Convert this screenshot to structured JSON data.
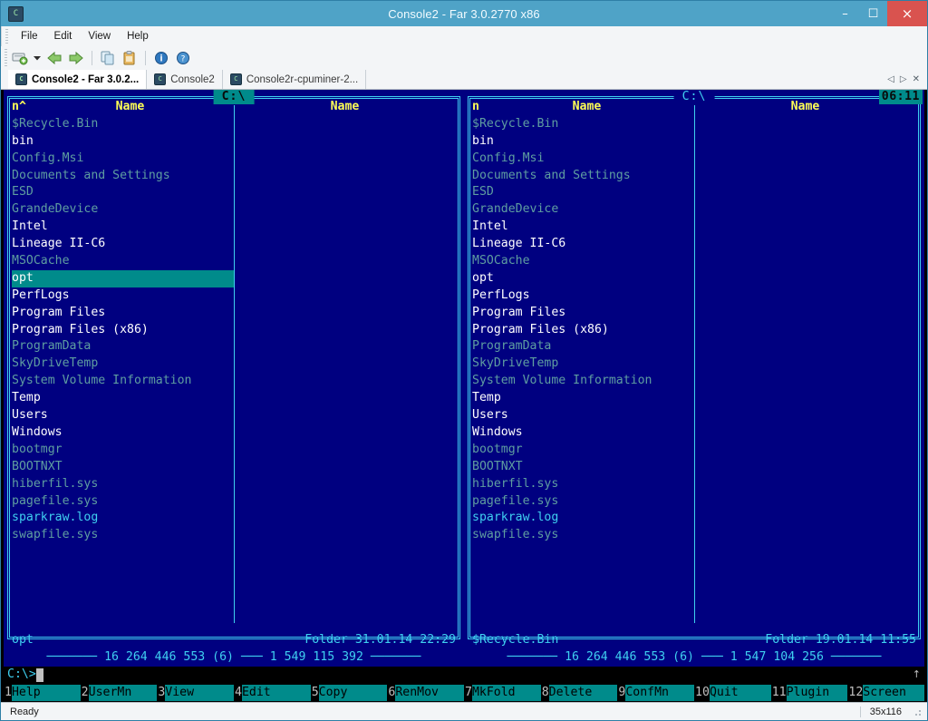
{
  "window": {
    "title": "Console2 - Far 3.0.2770 x86",
    "app_icon": "console-icon",
    "minimize_label": "–",
    "maximize_label": "☐",
    "close_label": "×"
  },
  "menu": {
    "items": [
      "File",
      "Edit",
      "View",
      "Help"
    ]
  },
  "toolbar": {
    "items": [
      {
        "name": "new-tab-icon",
        "glyph": "❐"
      },
      {
        "name": "new-tab-dropdown-icon",
        "glyph": "▼"
      },
      {
        "name": "back-icon",
        "glyph": "←"
      },
      {
        "name": "forward-icon",
        "glyph": "→"
      },
      {
        "name": "copy-icon",
        "glyph": "⧉"
      },
      {
        "name": "paste-icon",
        "glyph": "ὌB"
      },
      {
        "name": "info-icon",
        "glyph": "i"
      },
      {
        "name": "help-icon",
        "glyph": "?"
      }
    ]
  },
  "tabs": {
    "items": [
      {
        "label": "Console2 - Far 3.0.2...",
        "active": true
      },
      {
        "label": "Console2",
        "active": false
      },
      {
        "label": "Console2r-cpuminer-2...",
        "active": false
      }
    ],
    "nav": {
      "prev": "◁",
      "next": "▷",
      "close": "✕"
    }
  },
  "far": {
    "clock": "06:11",
    "left_panel": {
      "title": "C:\\",
      "active": true,
      "header": {
        "sort_mark": "n^",
        "col1": "Name",
        "col2": "Name"
      },
      "entries": [
        {
          "name": "$Recycle.Bin",
          "style": "dim"
        },
        {
          "name": "bin",
          "style": "white"
        },
        {
          "name": "Config.Msi",
          "style": "dim"
        },
        {
          "name": "Documents and Settings",
          "style": "dim"
        },
        {
          "name": "ESD",
          "style": "dim"
        },
        {
          "name": "GrandeDevice",
          "style": "dim"
        },
        {
          "name": "Intel",
          "style": "white"
        },
        {
          "name": "Lineage II-C6",
          "style": "white"
        },
        {
          "name": "MSOCache",
          "style": "dim"
        },
        {
          "name": "opt",
          "style": "white",
          "selected": true
        },
        {
          "name": "PerfLogs",
          "style": "white"
        },
        {
          "name": "Program Files",
          "style": "white"
        },
        {
          "name": "Program Files (x86)",
          "style": "white"
        },
        {
          "name": "ProgramData",
          "style": "dim"
        },
        {
          "name": "SkyDriveTemp",
          "style": "dim"
        },
        {
          "name": "System Volume Information",
          "style": "dim"
        },
        {
          "name": "Temp",
          "style": "white"
        },
        {
          "name": "Users",
          "style": "white"
        },
        {
          "name": "Windows",
          "style": "white"
        },
        {
          "name": "bootmgr",
          "style": "dim"
        },
        {
          "name": "BOOTNXT",
          "style": "dim"
        },
        {
          "name": "hiberfil.sys",
          "style": "dim"
        },
        {
          "name": "pagefile.sys",
          "style": "dim"
        },
        {
          "name": "sparkraw.log",
          "style": "cyan"
        },
        {
          "name": "swapfile.sys",
          "style": "dim"
        }
      ],
      "info_name": "opt",
      "info_meta": "Folder 31.01.14 22:29",
      "totals_left": "16 264 446 553 (6)",
      "totals_right": "1 549 115 392"
    },
    "right_panel": {
      "title": "C:\\",
      "active": false,
      "header": {
        "sort_mark": "n",
        "col1": "Name",
        "col2": "Name"
      },
      "entries": [
        {
          "name": "$Recycle.Bin",
          "style": "dim"
        },
        {
          "name": "bin",
          "style": "white"
        },
        {
          "name": "Config.Msi",
          "style": "dim"
        },
        {
          "name": "Documents and Settings",
          "style": "dim"
        },
        {
          "name": "ESD",
          "style": "dim"
        },
        {
          "name": "GrandeDevice",
          "style": "dim"
        },
        {
          "name": "Intel",
          "style": "white"
        },
        {
          "name": "Lineage II-C6",
          "style": "white"
        },
        {
          "name": "MSOCache",
          "style": "dim"
        },
        {
          "name": "opt",
          "style": "white"
        },
        {
          "name": "PerfLogs",
          "style": "white"
        },
        {
          "name": "Program Files",
          "style": "white"
        },
        {
          "name": "Program Files (x86)",
          "style": "white"
        },
        {
          "name": "ProgramData",
          "style": "dim"
        },
        {
          "name": "SkyDriveTemp",
          "style": "dim"
        },
        {
          "name": "System Volume Information",
          "style": "dim"
        },
        {
          "name": "Temp",
          "style": "white"
        },
        {
          "name": "Users",
          "style": "white"
        },
        {
          "name": "Windows",
          "style": "white"
        },
        {
          "name": "bootmgr",
          "style": "dim"
        },
        {
          "name": "BOOTNXT",
          "style": "dim"
        },
        {
          "name": "hiberfil.sys",
          "style": "dim"
        },
        {
          "name": "pagefile.sys",
          "style": "dim"
        },
        {
          "name": "sparkraw.log",
          "style": "cyan"
        },
        {
          "name": "swapfile.sys",
          "style": "dim"
        }
      ],
      "info_name": "$Recycle.Bin",
      "info_meta": "Folder 19.01.14 11:55",
      "totals_left": "16 264 446 553 (6)",
      "totals_right": "1 547 104 256"
    },
    "command_line": {
      "prompt": "C:\\>",
      "value": "",
      "scroll_indicator": "↑"
    },
    "function_keys": [
      {
        "num": "1",
        "label": "Help"
      },
      {
        "num": "2",
        "label": "UserMn"
      },
      {
        "num": "3",
        "label": "View"
      },
      {
        "num": "4",
        "label": "Edit"
      },
      {
        "num": "5",
        "label": "Copy"
      },
      {
        "num": "6",
        "label": "RenMov"
      },
      {
        "num": "7",
        "label": "MkFold"
      },
      {
        "num": "8",
        "label": "Delete"
      },
      {
        "num": "9",
        "label": "ConfMn"
      },
      {
        "num": "10",
        "label": "Quit"
      },
      {
        "num": "11",
        "label": "Plugin"
      },
      {
        "num": "12",
        "label": "Screen"
      }
    ]
  },
  "statusbar": {
    "text": "Ready",
    "size": "35x116"
  },
  "colors": {
    "titlebar": "#4fa3c7",
    "close_button": "#d9534f",
    "panel_bg": "#000080",
    "panel_border": "#3fd0f0",
    "selection": "#008b8b",
    "header_text": "#ffff55",
    "dim_file": "#5f9ea0",
    "normal_file": "#ffffff"
  }
}
